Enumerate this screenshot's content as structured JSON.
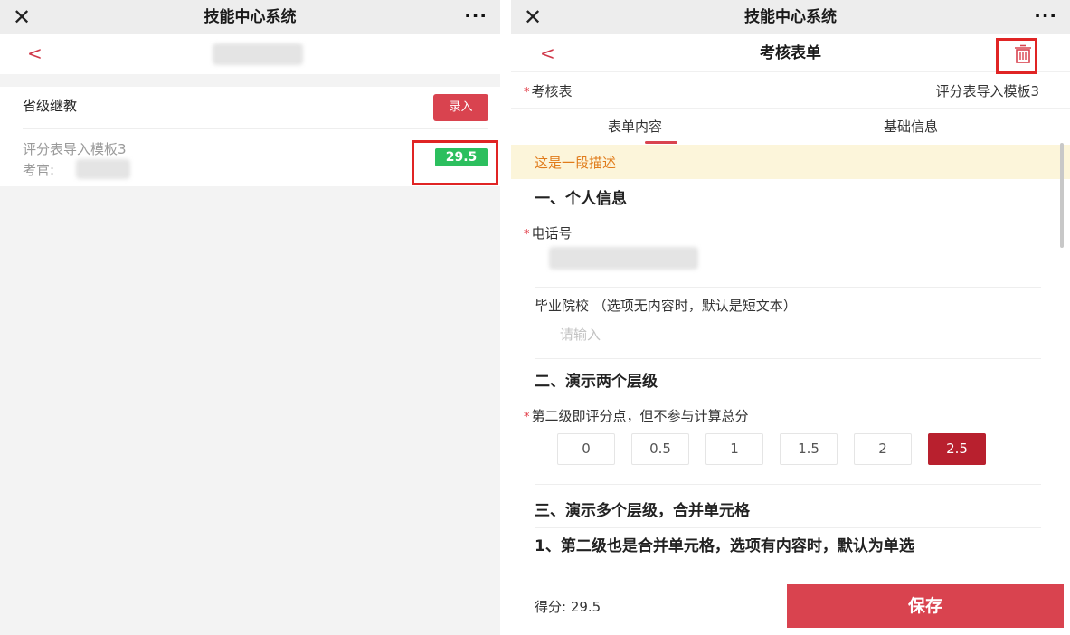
{
  "app": {
    "window_title": "技能中心系统",
    "more_label": "···"
  },
  "colors": {
    "accent": "#d9434f",
    "success_badge": "#2cbf5e",
    "selected_option": "#b8202e",
    "description_bg": "#fcf5da",
    "description_text": "#e07b1a",
    "highlight_box": "#e02424"
  },
  "left": {
    "back_label": "<",
    "section_title": "省级继教",
    "entry_button": "录入",
    "item": {
      "title": "评分表导入模板3",
      "examiner_label": "考官:",
      "score": "29.5"
    }
  },
  "right": {
    "back_label": "<",
    "page_title": "考核表单",
    "exam_table_label": "考核表",
    "exam_table_value": "评分表导入模板3",
    "tabs": [
      {
        "label": "表单内容",
        "active": true
      },
      {
        "label": "基础信息",
        "active": false
      }
    ],
    "description": "这是一段描述",
    "sections": {
      "s1": "一、个人信息",
      "s2": "二、演示两个层级",
      "s3": "三、演示多个层级，合并单元格"
    },
    "fields": {
      "phone_label": "电话号",
      "school_label": "毕业院校 （选项无内容时，默认是短文本）",
      "school_placeholder": "请输入",
      "level2_label": "第二级即评分点，但不参与计算总分",
      "sub_question": "1、第二级也是合并单元格，选项有内容时，默认为单选"
    },
    "score_options": [
      "0",
      "0.5",
      "1",
      "1.5",
      "2",
      "2.5"
    ],
    "selected_score": "2.5",
    "footer": {
      "score_text": "得分: 29.5",
      "save_label": "保存"
    }
  }
}
